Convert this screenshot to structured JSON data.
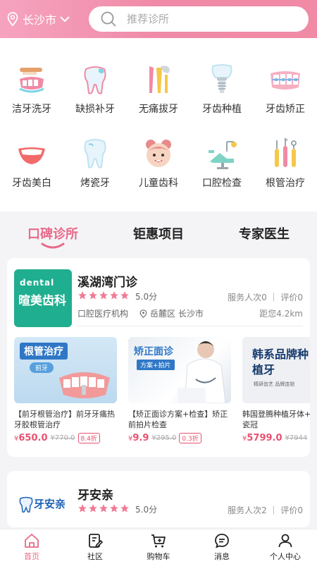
{
  "header": {
    "city": "长沙市",
    "search_placeholder": "推荐诊所"
  },
  "categories": [
    {
      "label": "洁牙洗牙",
      "icon": "tooth-brush-icon"
    },
    {
      "label": "缺损补牙",
      "icon": "tooth-repair-icon"
    },
    {
      "label": "无痛拔牙",
      "icon": "tooth-extraction-icon"
    },
    {
      "label": "牙齿种植",
      "icon": "tooth-implant-icon"
    },
    {
      "label": "牙齿矫正",
      "icon": "braces-icon"
    },
    {
      "label": "牙齿美白",
      "icon": "smile-icon"
    },
    {
      "label": "烤瓷牙",
      "icon": "porcelain-tooth-icon"
    },
    {
      "label": "儿童齿科",
      "icon": "child-face-icon"
    },
    {
      "label": "口腔检查",
      "icon": "dental-chair-icon"
    },
    {
      "label": "根管治疗",
      "icon": "dental-tools-icon"
    }
  ],
  "tabs": [
    {
      "label": "口碑诊所",
      "active": true
    },
    {
      "label": "钜惠项目",
      "active": false
    },
    {
      "label": "专家医生",
      "active": false
    }
  ],
  "clinics": [
    {
      "name": "溪湖湾门诊",
      "logo_text": "暄美齿科",
      "logo_sub": "dental",
      "score": "5.0分",
      "rating_stars": 5,
      "stats": "服务人次0 ｜ 评价0",
      "type": "口腔医疗机构",
      "address": "岳麓区 长沙市",
      "distance": "距您4.2km",
      "promos": [
        {
          "image_tag": "根管治疗",
          "image_sub": "前牙",
          "title": "【前牙根管治疗】前牙牙痛热牙胶根管治疗",
          "price_symbol": "¥",
          "price": "650.0",
          "old_price": "¥770.0",
          "discount": "8.4折"
        },
        {
          "image_tag": "矫正面诊",
          "image_sub": "方案+拍片",
          "title": "【矫正面诊方案+检查】矫正前拍片检查",
          "price_symbol": "¥",
          "price": "9.9",
          "old_price": "¥295.0",
          "discount": "0.3折"
        },
        {
          "image_tag": "韩系品牌种植牙",
          "image_sub": "精研齿艺 品牌连锁",
          "title": "韩国登腾种植牙体+基台+全瓷冠",
          "price_symbol": "¥",
          "price": "5799.0",
          "old_price": "¥7944",
          "discount": ""
        }
      ]
    },
    {
      "name": "牙安亲",
      "logo_text": "牙安亲",
      "score": "5.0分",
      "rating_stars": 5,
      "stats": "服务人次2 ｜ 评价0"
    }
  ],
  "nav": [
    {
      "label": "首页",
      "icon": "home-icon",
      "active": true
    },
    {
      "label": "社区",
      "icon": "community-icon",
      "active": false
    },
    {
      "label": "购物车",
      "icon": "cart-icon",
      "active": false
    },
    {
      "label": "消息",
      "icon": "message-icon",
      "active": false
    },
    {
      "label": "个人中心",
      "icon": "user-icon",
      "active": false
    }
  ],
  "colors": {
    "accent": "#e86a8a",
    "header_start": "#f6a3bf",
    "header_end": "#f08aa5",
    "price": "#e8516f",
    "star": "#f07a95",
    "logo_green": "#1fae8f"
  }
}
